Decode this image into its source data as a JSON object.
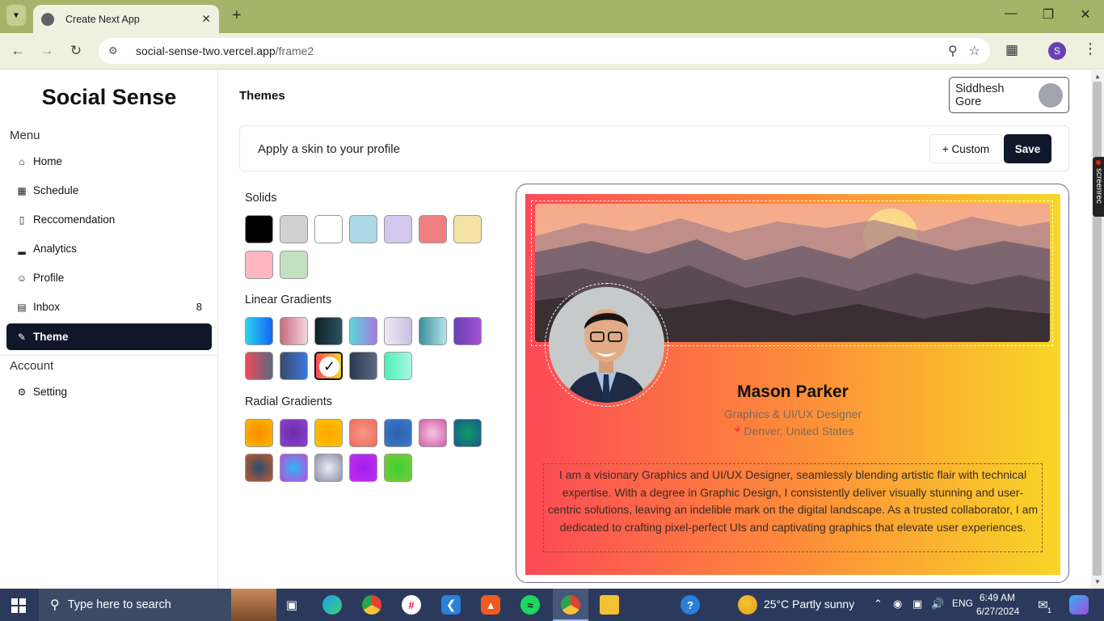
{
  "browser": {
    "tab_title": "Create Next App",
    "url_host": "social-sense-two.vercel.app",
    "url_path": "/frame2",
    "profile_initial": "S"
  },
  "sidebar": {
    "brand": "Social Sense",
    "menu_heading": "Menu",
    "items": [
      {
        "label": "Home",
        "icon": "home-icon"
      },
      {
        "label": "Schedule",
        "icon": "calendar-icon"
      },
      {
        "label": "Reccomendation",
        "icon": "document-icon"
      },
      {
        "label": "Analytics",
        "icon": "bar-chart-icon"
      },
      {
        "label": "Profile",
        "icon": "user-icon"
      },
      {
        "label": "Inbox",
        "icon": "inbox-icon",
        "badge": "8"
      },
      {
        "label": "Theme",
        "icon": "paint-roller-icon",
        "active": true
      }
    ],
    "account_heading": "Account",
    "account_items": [
      {
        "label": "Setting",
        "icon": "gear-icon"
      }
    ]
  },
  "header": {
    "title": "Themes",
    "user_name": "Siddhesh Gore"
  },
  "skin_bar": {
    "label": "Apply a skin to your profile",
    "custom_button": "+ Custom",
    "save_button": "Save"
  },
  "theme_groups": {
    "solids_heading": "Solids",
    "linear_heading": "Linear Gradients",
    "radial_heading": "Radial Gradients",
    "selected": "linear-10"
  },
  "preview": {
    "name": "Mason Parker",
    "role": "Graphics & UI/UX Designer",
    "location": "Denver, United States",
    "bio": "I am a visionary Graphics and UI/UX Designer, seamlessly blending artistic flair with technical expertise. With a degree in Graphic Design, I consistently deliver visually stunning and user-centric solutions, leaving an indelible mark on the digital landscape. As a trusted collaborator, I am dedicated to crafting pixel-perfect UIs and captivating graphics that elevate user experiences."
  },
  "taskbar": {
    "search_placeholder": "Type here to search",
    "weather": "25°C  Partly sunny",
    "language": "ENG",
    "time": "6:49 AM",
    "date": "6/27/2024",
    "notification_count": "1"
  },
  "screen_recorder": "screenrec"
}
